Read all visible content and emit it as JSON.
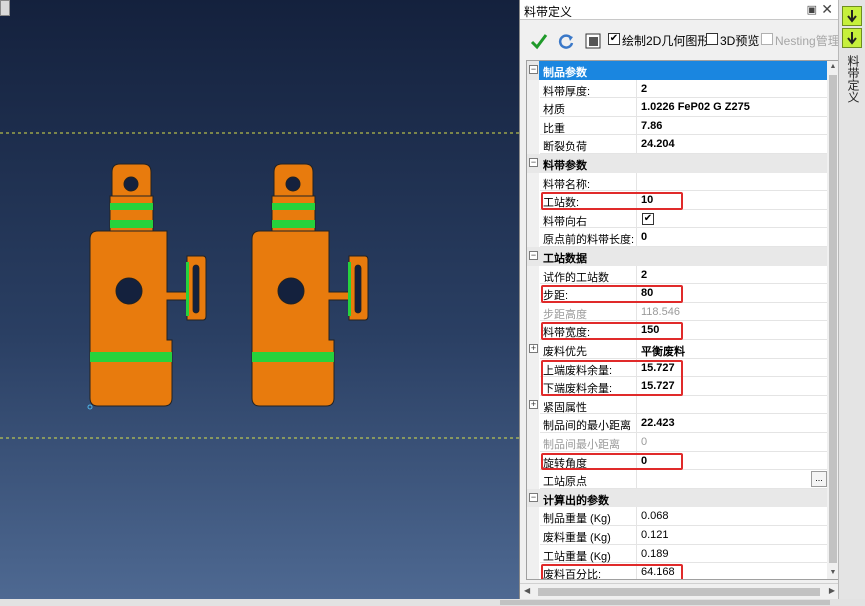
{
  "panel": {
    "title": "料带定义"
  },
  "toolbar": {
    "draw2d_label": "绘制2D几何图形",
    "draw2d_checked": "✔",
    "preview3d_label": "3D预览",
    "nesting_label": "Nesting管理"
  },
  "side_tab": {
    "label": "料带定义"
  },
  "grid": {
    "rows": [
      {
        "kind": "section",
        "label": "制品参数",
        "expander": "−",
        "selected": true
      },
      {
        "kind": "prop",
        "label": "料带厚度:",
        "value": "2",
        "bold": true
      },
      {
        "kind": "prop",
        "label": "材质",
        "value": "1.0226 FeP02 G Z275",
        "bold": true
      },
      {
        "kind": "prop",
        "label": "比重",
        "value": "7.86",
        "bold": true
      },
      {
        "kind": "prop",
        "label": "断裂负荷",
        "value": "24.204",
        "bold": true
      },
      {
        "kind": "section",
        "label": "料带参数",
        "expander": "−"
      },
      {
        "kind": "prop",
        "label": "料带名称:",
        "value": ""
      },
      {
        "kind": "prop",
        "label": "工站数:",
        "value": "10",
        "bold": true,
        "highlight": true
      },
      {
        "kind": "prop",
        "label": "料带向右",
        "value": "✔",
        "check": true
      },
      {
        "kind": "prop",
        "label": "原点前的料带长度:",
        "value": "0",
        "bold": true
      },
      {
        "kind": "section",
        "label": "工站数据",
        "expander": "−"
      },
      {
        "kind": "prop",
        "label": "试作的工站数",
        "value": "2",
        "bold": true
      },
      {
        "kind": "prop",
        "label": "步距:",
        "value": "80",
        "bold": true,
        "highlight": true
      },
      {
        "kind": "prop",
        "label": "步距高度",
        "value": "118.546",
        "grey": true
      },
      {
        "kind": "prop",
        "label": "料带宽度:",
        "value": "150",
        "bold": true,
        "highlight": true
      },
      {
        "kind": "prop",
        "label": "废料优先",
        "value": "平衡废料",
        "bold": true,
        "expander": "+"
      },
      {
        "kind": "prop",
        "label": "上端废料余量:",
        "value": "15.727",
        "bold": true,
        "highlight": true
      },
      {
        "kind": "prop",
        "label": "下端废料余量:",
        "value": "15.727",
        "bold": true,
        "highlight": true
      },
      {
        "kind": "prop",
        "label": "紧固属性",
        "value": "",
        "expander": "+"
      },
      {
        "kind": "prop",
        "label": "制品间的最小距离",
        "value": "22.423",
        "bold": true
      },
      {
        "kind": "prop",
        "label": "制品间最小距离",
        "value": "0",
        "grey": true
      },
      {
        "kind": "prop",
        "label": "旋转角度",
        "value": "0",
        "bold": true,
        "highlight": true
      },
      {
        "kind": "prop",
        "label": "工站原点",
        "value": "",
        "ellipsis": "..."
      },
      {
        "kind": "section",
        "label": "计算出的参数",
        "expander": "−"
      },
      {
        "kind": "prop",
        "label": "制品重量 (Kg)",
        "value": "0.068"
      },
      {
        "kind": "prop",
        "label": "废料重量 (Kg)",
        "value": "0.121"
      },
      {
        "kind": "prop",
        "label": "工站重量 (Kg)",
        "value": "0.189"
      },
      {
        "kind": "prop",
        "label": "废料百分比:",
        "value": "64.168",
        "highlight": true
      }
    ]
  },
  "colors": {
    "part_fill": "#e87b0d",
    "bend_green": "#27d23c",
    "highlight_box": "#e02a2a",
    "selected_row": "#1a86e0",
    "strip_edge": "#d9e04a"
  },
  "icons": {
    "apply": "check-icon",
    "refresh": "refresh-icon",
    "layout": "layout-icon"
  }
}
